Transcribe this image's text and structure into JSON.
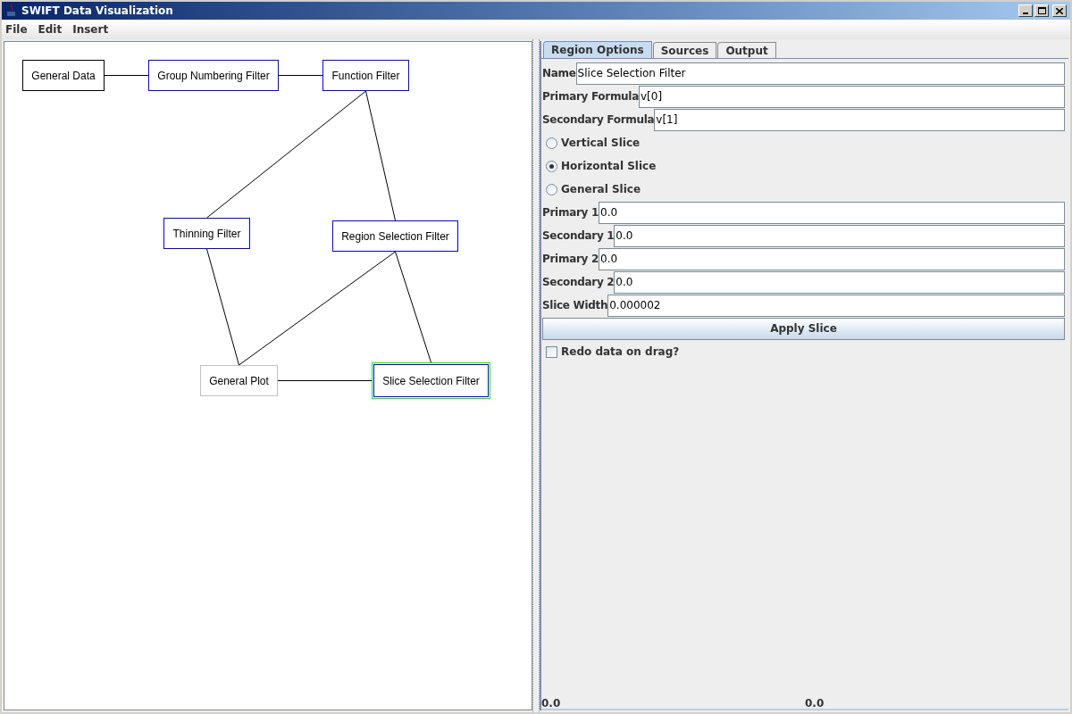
{
  "window": {
    "title": "SWIFT Data Visualization"
  },
  "menu": [
    "File",
    "Edit",
    "Insert"
  ],
  "diagram": {
    "nodes": [
      {
        "label": "General Data",
        "color": "#000000",
        "selected": false
      },
      {
        "label": "Group Numbering Filter",
        "color": "#0000ff",
        "selected": false
      },
      {
        "label": "Function Filter",
        "color": "#0000ff",
        "selected": false
      },
      {
        "label": "Thinning Filter",
        "color": "#0000ff",
        "selected": false
      },
      {
        "label": "Region Selection Filter",
        "color": "#0000ff",
        "selected": false
      },
      {
        "label": "General Plot",
        "color": "#c0c0c0",
        "selected": false
      },
      {
        "label": "Slice Selection Filter",
        "color": "#0000ff",
        "selected": true
      }
    ]
  },
  "tabs": [
    {
      "label": "Region Options",
      "selected": true
    },
    {
      "label": "Sources",
      "selected": false
    },
    {
      "label": "Output",
      "selected": false
    }
  ],
  "form": [
    {
      "kind": "field",
      "label": "Name",
      "value": "Slice Selection Filter"
    },
    {
      "kind": "field",
      "label": "Primary Formula",
      "value": "v[0]"
    },
    {
      "kind": "field",
      "label": "Secondary Formula",
      "value": "v[1]"
    },
    {
      "kind": "radio",
      "label": "Vertical Slice",
      "selected": false
    },
    {
      "kind": "radio",
      "label": "Horizontal Slice",
      "selected": true
    },
    {
      "kind": "radio",
      "label": "General Slice",
      "selected": false
    },
    {
      "kind": "field",
      "label": "Primary 1",
      "value": "0.0"
    },
    {
      "kind": "field",
      "label": "Secondary 1",
      "value": "0.0"
    },
    {
      "kind": "field",
      "label": "Primary 2",
      "value": "0.0"
    },
    {
      "kind": "field",
      "label": "Secondary 2",
      "value": "0.0"
    },
    {
      "kind": "field",
      "label": "Slice Width",
      "value": "0.000002"
    },
    {
      "kind": "button",
      "label": "Apply Slice"
    },
    {
      "kind": "checkbox",
      "label": "Redo data on drag?",
      "checked": false
    }
  ],
  "status": [
    "0.0",
    "0.0"
  ]
}
